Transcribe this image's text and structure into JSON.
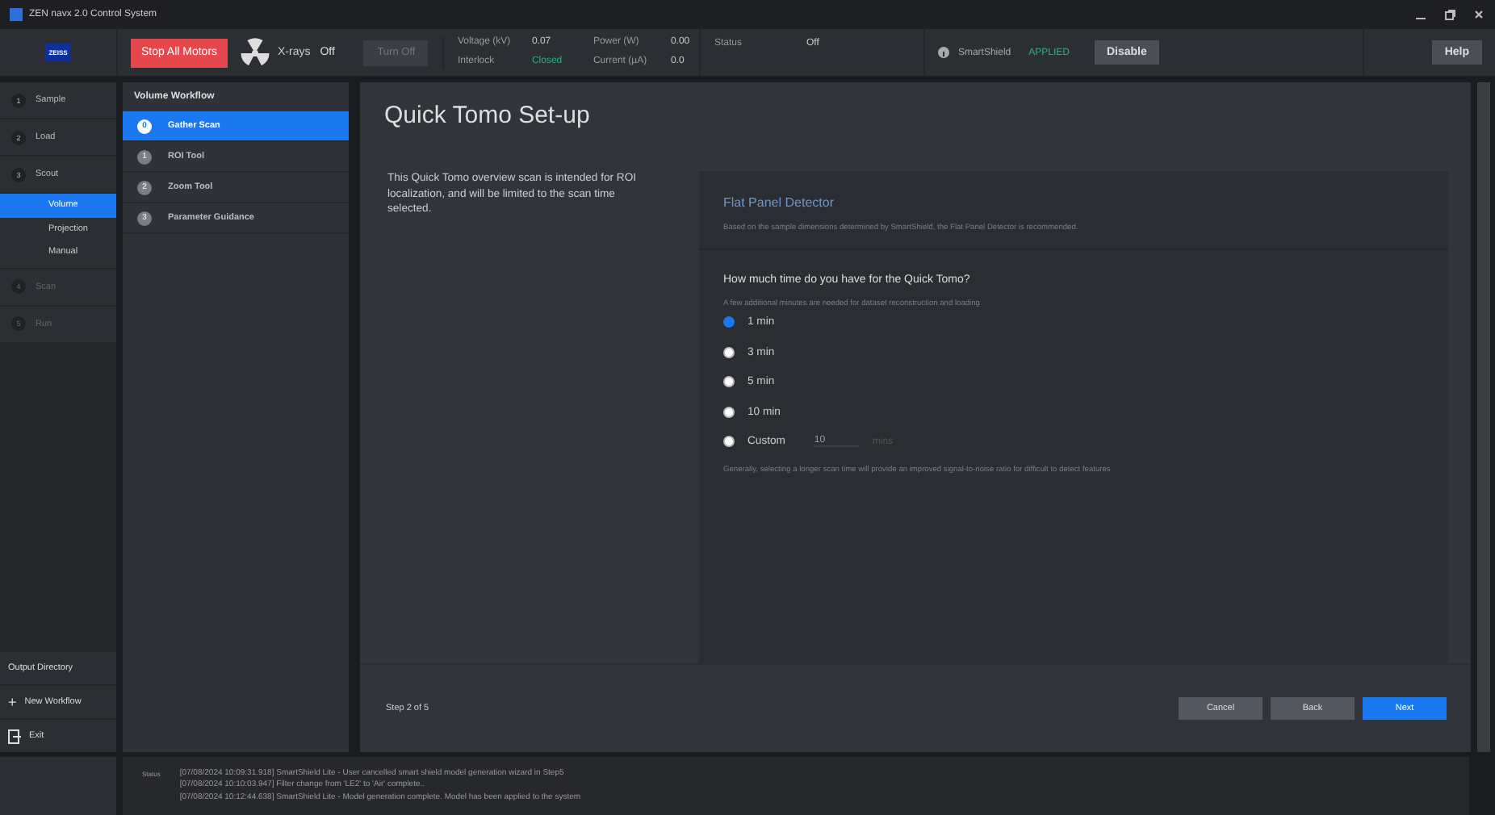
{
  "window": {
    "title": "ZEN navx 2.0 Control System"
  },
  "toolbar": {
    "logo": "ZEISS",
    "stop_button": "Stop All Motors",
    "xray_label": "X-rays",
    "xray_state": "Off",
    "turn_off_button": "Turn Off",
    "turn_off_disabled": true,
    "readings": [
      {
        "label": "Voltage (kV)",
        "value": "0.07",
        "ok": false
      },
      {
        "label": "Power (W)",
        "value": "0.00",
        "ok": false
      },
      {
        "label": "Interlock",
        "value": "Closed",
        "ok": true
      },
      {
        "label": "Current (µA)",
        "value": "0.0",
        "ok": false
      }
    ],
    "status": {
      "label": "Status",
      "value": "Off"
    },
    "smartshield": {
      "label": "SmartShield",
      "state": "APPLIED",
      "button": "Disable"
    },
    "help_button": "Help"
  },
  "nav": {
    "items": [
      {
        "number": "1",
        "label": "Sample",
        "disabled": false
      },
      {
        "number": "2",
        "label": "Load",
        "disabled": false
      },
      {
        "number": "3",
        "label": "Scout",
        "disabled": false,
        "children": [
          {
            "label": "Volume",
            "selected": true
          },
          {
            "label": "Projection",
            "selected": false
          },
          {
            "label": "Manual",
            "selected": false
          }
        ]
      },
      {
        "number": "4",
        "label": "Scan",
        "disabled": true
      },
      {
        "number": "5",
        "label": "Run",
        "disabled": true
      }
    ],
    "output_directory": "Output Directory",
    "new_workflow": "New Workflow",
    "new_workflow_icon": "+",
    "exit": "Exit"
  },
  "workflow": {
    "title": "Volume Workflow",
    "steps": [
      {
        "number": "0",
        "label": "Gather Scan",
        "selected": true
      },
      {
        "number": "1",
        "label": "ROI Tool",
        "selected": false
      },
      {
        "number": "2",
        "label": "Zoom Tool",
        "selected": false
      },
      {
        "number": "3",
        "label": "Parameter Guidance",
        "selected": false
      }
    ]
  },
  "main": {
    "title": "Quick Tomo Set-up",
    "description": "This Quick Tomo overview scan is intended for ROI localization, and will be limited to the scan time selected.",
    "detector": {
      "title": "Flat Panel Detector",
      "note": "Based on the sample dimensions determined by SmartShield, the Flat Panel Detector is recommended."
    },
    "question": "How much time do you have for the Quick Tomo?",
    "hint": "A few additional minutes are needed for dataset reconstruction and loading",
    "options": [
      {
        "kind": "preset",
        "label": "1 min",
        "selected": true
      },
      {
        "kind": "preset",
        "label": "3 min",
        "selected": false
      },
      {
        "kind": "preset",
        "label": "5 min",
        "selected": false
      },
      {
        "kind": "preset",
        "label": "10 min",
        "selected": false
      },
      {
        "kind": "custom",
        "label": "Custom",
        "selected": false,
        "value": "10",
        "unit": "mins"
      }
    ],
    "footnote": "Generally, selecting a longer scan time will provide an improved signal-to-noise ratio for difficult to detect features",
    "step": "Step 2 of 5",
    "buttons": [
      {
        "label": "Cancel",
        "primary": false
      },
      {
        "label": "Back",
        "primary": false
      },
      {
        "label": "Next",
        "primary": true
      }
    ]
  },
  "status_log": {
    "label": "Status",
    "lines": [
      "[07/08/2024 10:09:31.918] SmartShield Lite - User cancelled smart shield model generation wizard in Step5",
      "[07/08/2024 10:10:03.947] Filter change from 'LE2' to 'Air' complete..",
      "[07/08/2024 10:12:44.638] SmartShield Lite - Model generation complete. Model has been applied to the system"
    ]
  }
}
